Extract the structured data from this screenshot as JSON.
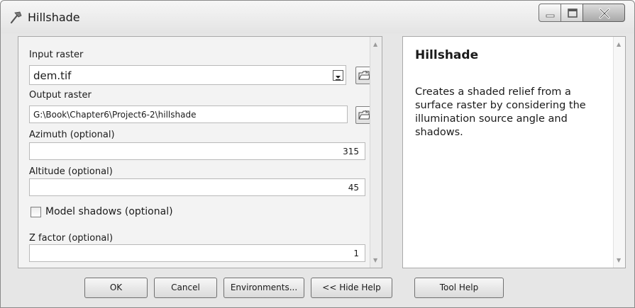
{
  "window": {
    "title": "Hillshade"
  },
  "form": {
    "input_raster": {
      "label": "Input raster",
      "value": "dem.tif"
    },
    "output_raster": {
      "label": "Output raster",
      "value": "G:\\Book\\Chapter6\\Project6-2\\hillshade"
    },
    "azimuth": {
      "label": "Azimuth (optional)",
      "value": "315"
    },
    "altitude": {
      "label": "Altitude (optional)",
      "value": "45"
    },
    "model_shadows": {
      "label": "Model shadows (optional)",
      "checked": false
    },
    "z_factor": {
      "label": "Z factor (optional)",
      "value": "1"
    }
  },
  "help": {
    "title": "Hillshade",
    "description": "Creates a shaded relief from a surface raster by considering the illumination source angle and shadows."
  },
  "buttons": {
    "ok": "OK",
    "cancel": "Cancel",
    "environments": "Environments...",
    "hide_help": "<< Hide Help",
    "tool_help": "Tool Help"
  },
  "icons": {
    "app": "hammer-icon",
    "browse": "open-folder-icon",
    "dropdown": "chevron-down-icon"
  }
}
